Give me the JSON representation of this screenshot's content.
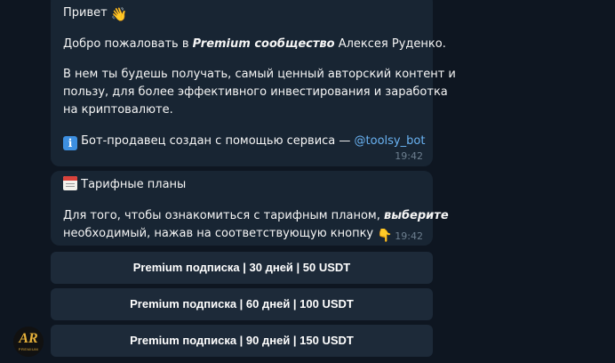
{
  "message1": {
    "greeting_text": "Привет",
    "greeting_emoji": "👋",
    "welcome_prefix": "Добро пожаловать в",
    "welcome_brand": "Premium сообщество",
    "welcome_suffix": "Алексея Руденко.",
    "body_line_1": "В нем ты будешь получать, самый ценный авторский контент и",
    "body_line_2": "пользу, для более эффективного инвестирования и заработка",
    "body_line_3": "на криптовалюте.",
    "info_icon_glyph": "i",
    "bot_note_text": "Бот-продавец создан с помощью сервиса —",
    "bot_link": "@toolsy_bot",
    "time": "19:42"
  },
  "message2": {
    "heading": "Тарифные планы",
    "line_1_text": "Для того, чтобы ознакомиться с тарифным планом,",
    "line_1_emphasis": "выберите",
    "line_2_text": "необходимый, нажав на соответствующую кнопку",
    "point_emoji": "👇",
    "time": "19:42"
  },
  "buttons": [
    {
      "label": "Premium подписка | 30 дней | 50 USDT"
    },
    {
      "label": "Premium подписка | 60 дней | 100 USDT"
    },
    {
      "label": "Premium подписка | 90 дней | 150 USDT"
    }
  ],
  "avatar": {
    "monogram": "AR",
    "caption": "PREMIUM"
  },
  "colors": {
    "background": "#0e1621",
    "bubble": "#182533",
    "button": "#1d2a39",
    "link": "#6ab3f3",
    "timestamp": "#6d7f8f",
    "avatar_gold": "#e8b23a"
  },
  "icons": [
    "waving-hand-icon",
    "info-icon",
    "calendar-icon",
    "pointing-down-icon"
  ]
}
